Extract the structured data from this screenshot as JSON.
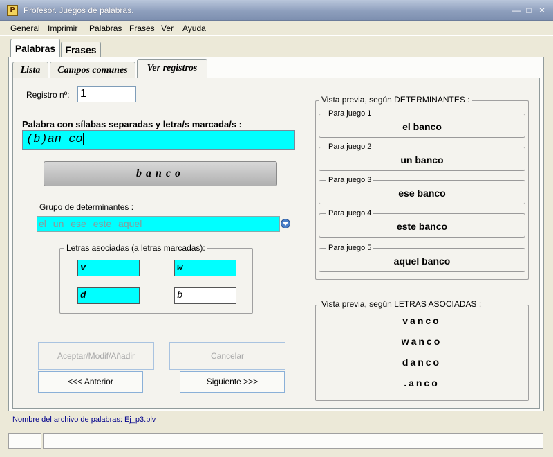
{
  "window": {
    "title": "Profesor.  Juegos de palabras."
  },
  "menu": [
    "General",
    "Imprimir",
    "Palabras",
    "Frases",
    "Ver",
    "Ayuda"
  ],
  "tabs": [
    "Palabras",
    "Frases"
  ],
  "subtabs": [
    "Lista",
    "Campos comunes",
    "Ver registros"
  ],
  "form": {
    "registro_label": "Registro nº:",
    "registro_value": "1",
    "palabra_label": "Palabra con sílabas separadas y letra/s marcada/s :",
    "palabra_value": "(b)an co",
    "word_display": "banco",
    "grupo_label": "Grupo de determinantes :",
    "grupo_value": "el  un  ese  este  aquel",
    "letras_legend": "Letras asociadas (a letras marcadas):",
    "letras": [
      "v",
      "w",
      "d",
      "b"
    ]
  },
  "buttons": {
    "aceptar": "Aceptar/Modif/Añadir",
    "cancelar": "Cancelar",
    "anterior": "<<< Anterior",
    "siguiente": "Siguiente >>>"
  },
  "preview_det": {
    "legend": "Vista previa, según DETERMINANTES :",
    "items": [
      {
        "label": "Para juego 1",
        "value": "el  banco"
      },
      {
        "label": "Para juego 2",
        "value": "un  banco"
      },
      {
        "label": "Para juego 3",
        "value": "ese  banco"
      },
      {
        "label": "Para juego 4",
        "value": "este  banco"
      },
      {
        "label": "Para juego 5",
        "value": "aquel  banco"
      }
    ]
  },
  "preview_letras": {
    "legend": "Vista previa, según LETRAS ASOCIADAS :",
    "items": [
      "vanco",
      "wanco",
      "danco",
      ".anco"
    ]
  },
  "status": {
    "filename": "Nombre del archivo de palabras:  Ej_p3.plv"
  }
}
